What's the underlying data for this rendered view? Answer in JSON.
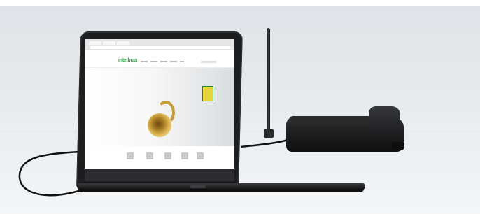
{
  "scene": {
    "description_labels": [],
    "laptop": {
      "screen": {
        "site_logo": "intelbras"
      }
    }
  },
  "colors": {
    "background": "#e8ecf0",
    "logo_green": "#2ea043",
    "device_black": "#1c1d1f"
  }
}
